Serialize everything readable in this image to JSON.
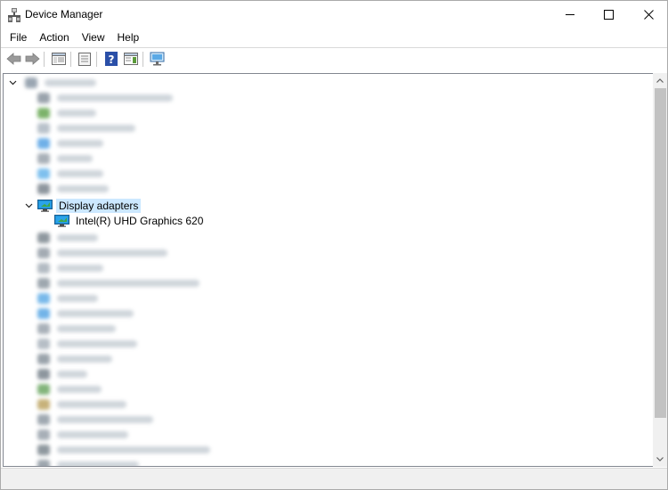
{
  "window": {
    "title": "Device Manager"
  },
  "menu": {
    "items": [
      "File",
      "Action",
      "View",
      "Help"
    ]
  },
  "toolbar": {
    "buttons": [
      "back-icon",
      "forward-icon",
      "properties-panel-icon",
      "device-list-icon",
      "help-icon",
      "console-tree-icon",
      "monitor-scan-icon"
    ]
  },
  "tree": {
    "expanded_category": "Display adapters",
    "expanded_child": "Intel(R) UHD Graphics 620"
  },
  "colors": {
    "selection": "#cce8ff",
    "scroll_thumb": "#c2c2c2",
    "accent_icon": "#1e90d6"
  }
}
